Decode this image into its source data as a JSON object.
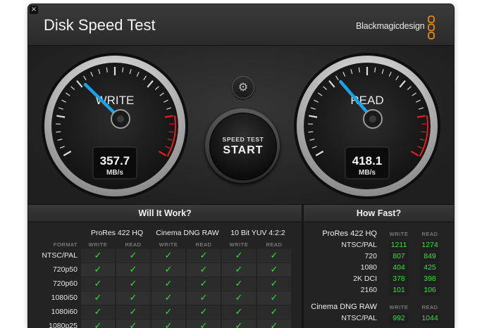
{
  "app": {
    "title": "Disk Speed Test",
    "brand": "Blackmagicdesign",
    "close_glyph": "×"
  },
  "gauges": {
    "write": {
      "label": "WRITE",
      "value": "357.7",
      "unit": "MB/s",
      "needle_fraction": 0.31
    },
    "read": {
      "label": "READ",
      "value": "418.1",
      "unit": "MB/s",
      "needle_fraction": 0.33
    }
  },
  "settings": {
    "icon": "gear-icon",
    "glyph": "⚙"
  },
  "start_button": {
    "small_label": "SPEED TEST",
    "big_label": "START"
  },
  "will_it_work": {
    "title": "Will It Work?",
    "format_header": "FORMAT",
    "write_header": "WRITE",
    "read_header": "READ",
    "check_glyph": "✓",
    "columns": [
      "ProRes 422 HQ",
      "Cinema DNG RAW",
      "10 Bit YUV 4:2:2"
    ],
    "rows": [
      "NTSC/PAL",
      "720p50",
      "720p60",
      "1080i50",
      "1080i60",
      "1080p25"
    ]
  },
  "how_fast": {
    "title": "How Fast?",
    "write_header": "WRITE",
    "read_header": "READ",
    "sections": [
      {
        "name": "ProRes 422 HQ",
        "rows": [
          {
            "label": "NTSC/PAL",
            "write": "1211",
            "read": "1274"
          },
          {
            "label": "720",
            "write": "807",
            "read": "849"
          },
          {
            "label": "1080",
            "write": "404",
            "read": "425"
          },
          {
            "label": "2K DCI",
            "write": "378",
            "read": "398"
          },
          {
            "label": "2160",
            "write": "101",
            "read": "106"
          }
        ]
      },
      {
        "name": "Cinema DNG RAW",
        "rows": [
          {
            "label": "NTSC/PAL",
            "write": "992",
            "read": "1044"
          }
        ]
      }
    ]
  },
  "colors": {
    "accent_needle": "#19a4e8",
    "ok_green": "#33e233",
    "redline": "#e02020"
  }
}
